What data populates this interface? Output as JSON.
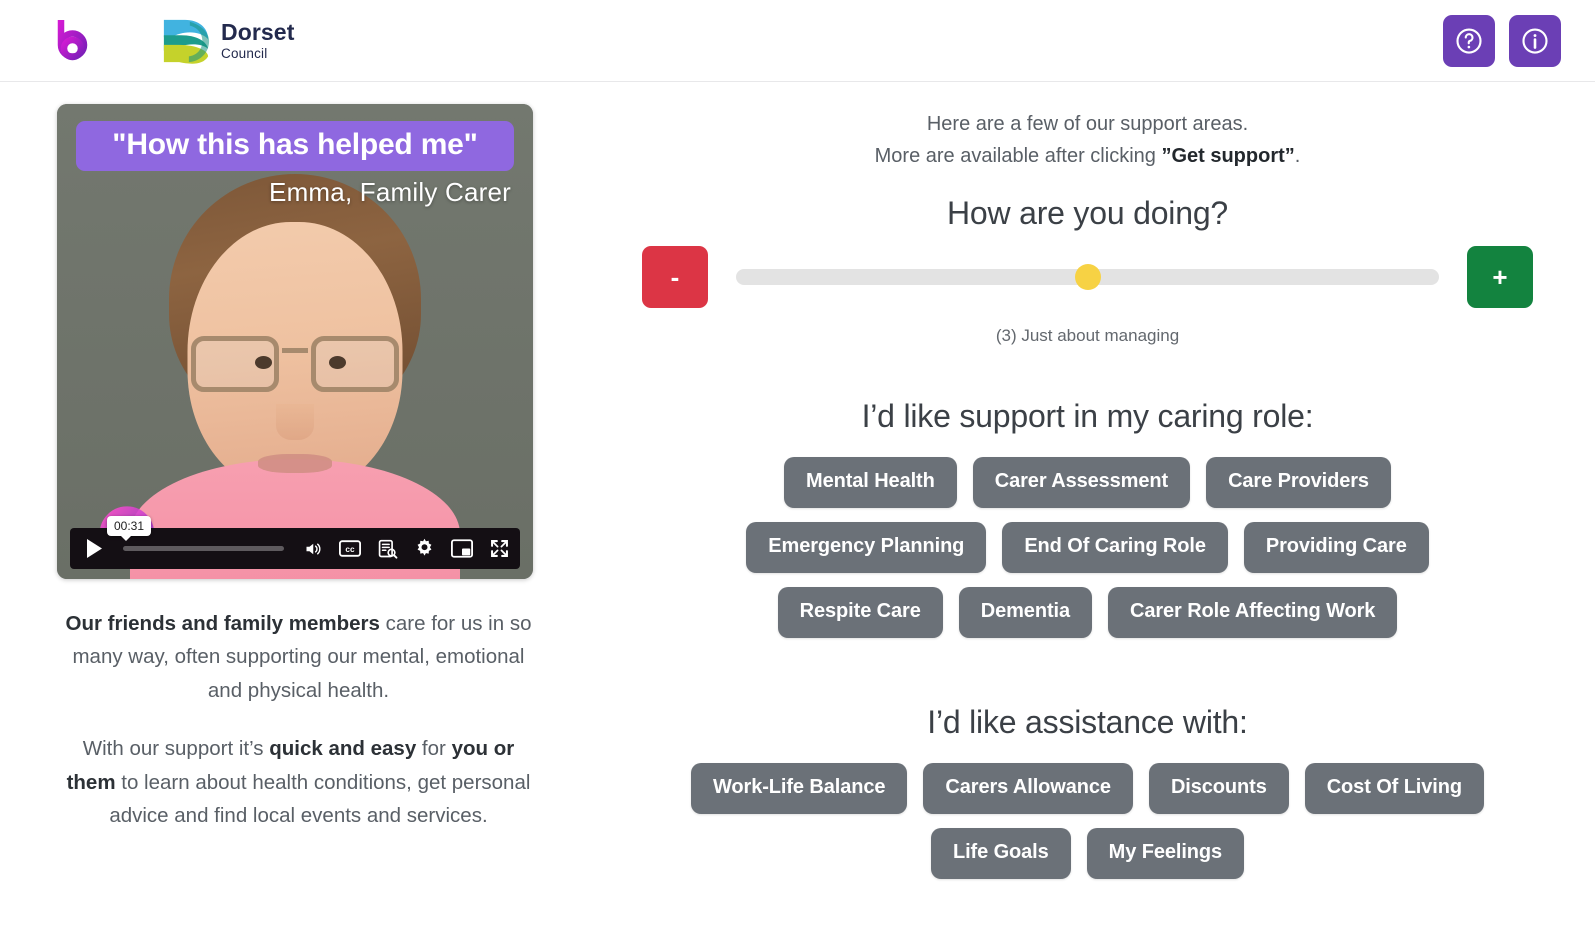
{
  "header": {
    "brand_icon": "beam-b-logo-icon",
    "council_line1": "Dorset",
    "council_line2": "Council",
    "help_icon": "question-mark-circle-icon",
    "info_icon": "info-circle-icon"
  },
  "video": {
    "title": "\"How this has helped me\"",
    "subtitle": "Emma, Family Carer",
    "current_time": "00:31",
    "play_icon": "play-icon",
    "volume_icon": "volume-icon",
    "captions_icon": "closed-captions-icon",
    "transcript_icon": "transcript-search-icon",
    "settings_icon": "gear-icon",
    "pip_icon": "picture-in-picture-icon",
    "fullscreen_icon": "fullscreen-icon",
    "watermark_icon": "beam-b-watermark-icon"
  },
  "left_copy": {
    "para1_bold": "Our friends and family members",
    "para1_rest": " care for us in so many way, often supporting our mental, emotional and physical health.",
    "para2_a": "With our support it’s ",
    "para2_b1": "quick and easy",
    "para2_c": " for ",
    "para2_b2": "you or them",
    "para2_d": " to learn about health conditions, get personal advice and find local events and services."
  },
  "intro": {
    "line1": "Here are a few of our support areas.",
    "line2_pre": "More are available after clicking ",
    "line2_bold": "”Get support”",
    "line2_post": "."
  },
  "mood": {
    "title": "How are you doing?",
    "decrease_label": "-",
    "increase_label": "+",
    "value": 3,
    "min": 1,
    "max": 5,
    "percent": 50,
    "value_label": "(3) Just about managing",
    "thumb_color": "#f7d244",
    "decrease_color": "#dc3545",
    "increase_color": "#13833f"
  },
  "caring_role": {
    "title": "I’d like support in my caring role:",
    "chips": [
      "Mental Health",
      "Carer Assessment",
      "Care Providers",
      "Emergency Planning",
      "End Of Caring Role",
      "Providing Care",
      "Respite Care",
      "Dementia",
      "Carer Role Affecting Work"
    ]
  },
  "assistance": {
    "title": "I’d like assistance with:",
    "chips": [
      "Work-Life Balance",
      "Carers Allowance",
      "Discounts",
      "Cost Of Living",
      "Life Goals",
      "My Feelings"
    ]
  },
  "colors": {
    "brand_purple": "#6b3fb5",
    "chip_gray": "#6b7178",
    "video_title_purple": "#8f68e0"
  }
}
